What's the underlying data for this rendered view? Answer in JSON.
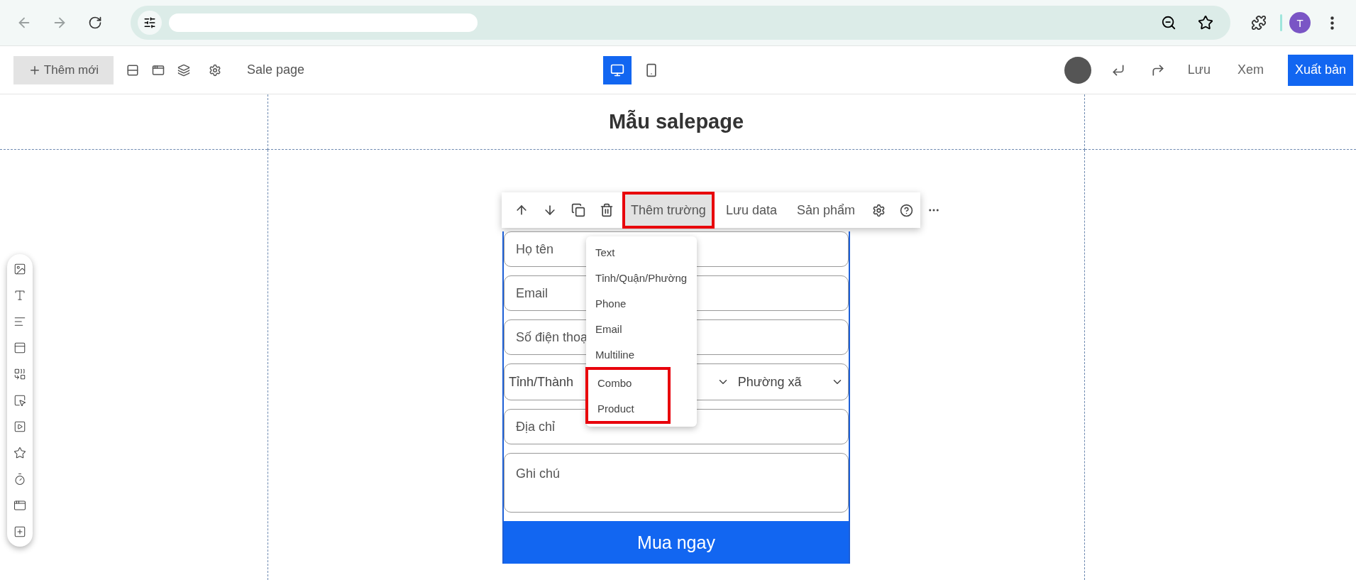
{
  "browser": {
    "profile_letter": "T"
  },
  "toolbar": {
    "add_label": "Thêm mới",
    "page_name": "Sale page",
    "views": [
      {
        "kind": "desktop",
        "selected": true
      },
      {
        "kind": "mobile",
        "selected": false
      }
    ],
    "actions": [
      "Lưu",
      "Xem"
    ],
    "publish": "Xuất bản"
  },
  "canvas": {
    "title": "Mẫu salepage"
  },
  "element_toolbar": {
    "tabs": [
      {
        "label": "Thêm trường",
        "selected": true,
        "annotated": true
      },
      {
        "label": "Lưu data",
        "selected": false,
        "annotated": false
      },
      {
        "label": "Sản phẩm",
        "selected": false,
        "annotated": false
      }
    ]
  },
  "field_menu": {
    "items": [
      {
        "label": "Text",
        "annotated": false
      },
      {
        "label": "Tỉnh/Quận/Phường",
        "annotated": false
      },
      {
        "label": "Phone",
        "annotated": false
      },
      {
        "label": "Email",
        "annotated": false
      },
      {
        "label": "Multiline",
        "annotated": false
      },
      {
        "label": "Combo",
        "annotated": true
      },
      {
        "label": "Product",
        "annotated": true
      }
    ]
  },
  "form": {
    "fields": [
      {
        "kind": "input",
        "placeholder": "Họ tên"
      },
      {
        "kind": "input",
        "placeholder": "Email"
      },
      {
        "kind": "input",
        "placeholder": "Số điện thoạ"
      },
      {
        "kind": "selects",
        "first": "Tỉnh/Thành",
        "third": "Phường xã"
      },
      {
        "kind": "input",
        "placeholder": "Địa chỉ"
      },
      {
        "kind": "textarea",
        "placeholder": "Ghi chú"
      }
    ],
    "submit": "Mua ngay"
  }
}
